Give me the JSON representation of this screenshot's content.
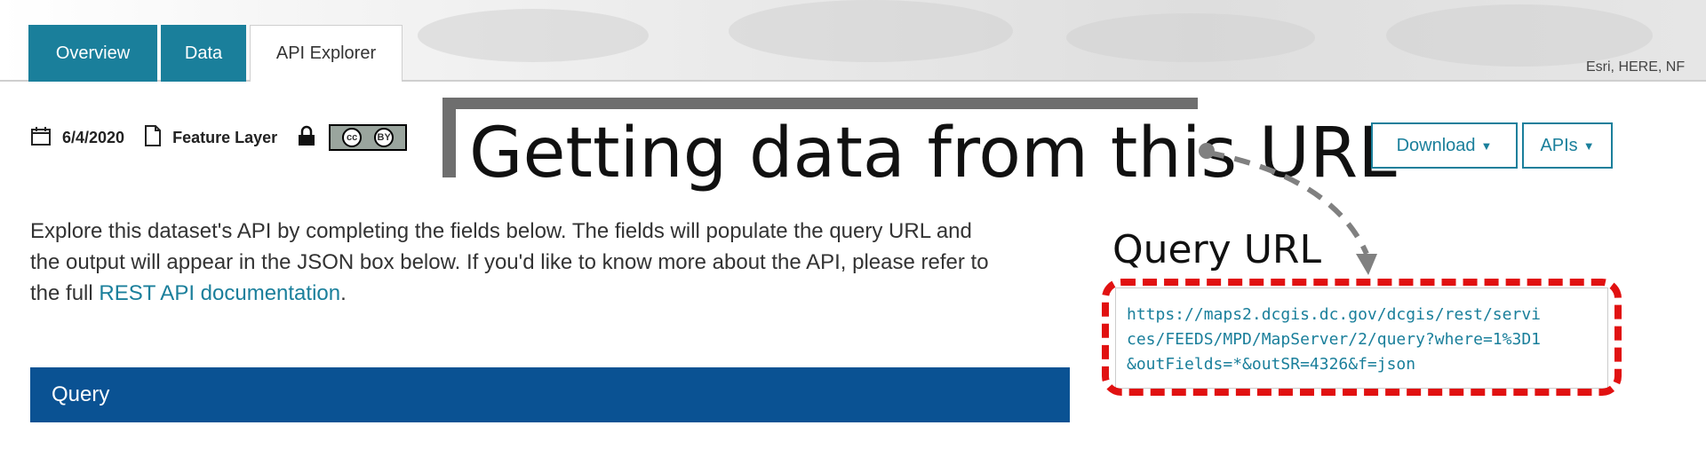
{
  "tabs": [
    {
      "label": "Overview"
    },
    {
      "label": "Data"
    },
    {
      "label": "API Explorer"
    }
  ],
  "map_attribution": "Esri, HERE, NF",
  "meta": {
    "date": "6/4/2020",
    "type": "Feature Layer",
    "license_badge": {
      "cc": "cc",
      "by": "BY"
    }
  },
  "callout": {
    "text": "Getting data from this URL"
  },
  "buttons": {
    "download": "Download",
    "apis": "APIs"
  },
  "description": {
    "line1": "Explore this dataset's API by completing the fields below. The fields will populate the query URL and",
    "line2": "the output will appear in the JSON box below. If you'd like to know more about the API, please refer to",
    "line3_prefix": "the full ",
    "link_text": "REST API documentation",
    "line3_suffix": "."
  },
  "query_section": {
    "title": "Query"
  },
  "query_url": {
    "title": "Query URL",
    "lines": [
      "https://maps2.dcgis.dc.gov/dcgis/rest/servi",
      "ces/FEEDS/MPD/MapServer/2/query?where=1%3D1",
      "&outFields=*&outSR=4326&f=json"
    ]
  },
  "colors": {
    "tab_teal": "#1a7f9b",
    "query_bar_blue": "#0a5293",
    "highlight_red": "#e11111"
  },
  "icons": {
    "date": "calendar-icon",
    "type": "document-icon",
    "lock": "lock-icon"
  }
}
